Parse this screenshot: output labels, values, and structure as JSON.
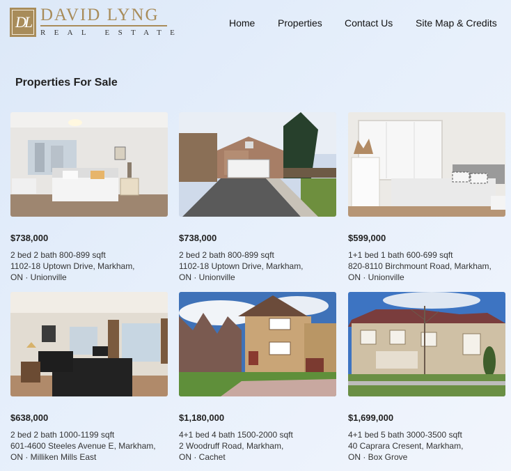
{
  "brand": {
    "monogram": "DL",
    "name": "DAVID LYNG",
    "tagline": "REAL ESTATE",
    "color": "#a88c5a"
  },
  "nav": {
    "items": [
      "Home",
      "Properties",
      "Contact Us",
      "Site Map & Credits"
    ]
  },
  "page": {
    "title": "Properties For Sale"
  },
  "listings": [
    {
      "price": "$738,000",
      "summary": "2 bed 2 bath 800-899 sqft",
      "address": "1102-18 Uptown Drive, Markham,",
      "area": "ON · Unionville",
      "photo": "modern bedroom interior"
    },
    {
      "price": "$738,000",
      "summary": "2 bed 2 bath 800-899 sqft",
      "address": "1102-18 Uptown Drive, Markham,",
      "area": "ON · Unionville",
      "photo": "two-storey house with garage"
    },
    {
      "price": "$599,000",
      "summary": "1+1 bed 1 bath 600-699 sqft",
      "address": "820-8110 Birchmount Road, Markham,",
      "area": "ON · Unionville",
      "photo": "bedroom with large window"
    },
    {
      "price": "$638,000",
      "summary": "2 bed 2 bath 1000-1199 sqft",
      "address": "601-4600 Steeles Avenue E, Markham,",
      "area": "ON · Milliken Mills East",
      "photo": "living room with black sofa"
    },
    {
      "price": "$1,180,000",
      "summary": "4+1 bed 4 bath 1500-2000 sqft",
      "address": "2 Woodruff Road, Markham,",
      "area": "ON · Cachet",
      "photo": "brick house with interlock driveway"
    },
    {
      "price": "$1,699,000",
      "summary": "4+1 bed 5 bath 3000-3500 sqft",
      "address": "40 Caprara Cresent, Markham,",
      "area": "ON · Box Grove",
      "photo": "large stone house"
    }
  ]
}
